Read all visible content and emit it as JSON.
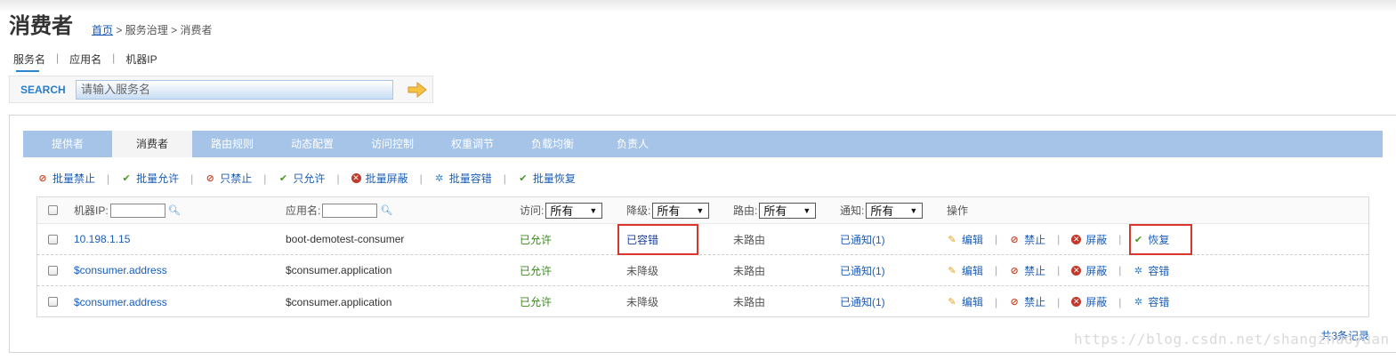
{
  "page": {
    "title": "消费者",
    "breadcrumb": {
      "home": "首页",
      "sep1": ">",
      "section": "服务治理",
      "sep2": ">",
      "current": "消费者"
    }
  },
  "search": {
    "tabs": [
      "服务名",
      "应用名",
      "机器IP"
    ],
    "separator": "|",
    "label": "SEARCH",
    "placeholder": "请输入服务名"
  },
  "nav": {
    "tabs": [
      "提供者",
      "消费者",
      "路由规则",
      "动态配置",
      "访问控制",
      "权重调节",
      "负载均衡",
      "负责人"
    ],
    "active": "消费者"
  },
  "batch_actions": [
    {
      "label": "批量禁止",
      "icon": "ban-icon"
    },
    {
      "label": "批量允许",
      "icon": "check-icon"
    },
    {
      "label": "只禁止",
      "icon": "ban-icon"
    },
    {
      "label": "只允许",
      "icon": "check-icon"
    },
    {
      "label": "批量屏蔽",
      "icon": "block-icon"
    },
    {
      "label": "批量容错",
      "icon": "gear-icon"
    },
    {
      "label": "批量恢复",
      "icon": "check-icon"
    }
  ],
  "table": {
    "headers": {
      "ip": "机器IP:",
      "app": "应用名:",
      "access": "访问:",
      "degrade": "降级:",
      "route": "路由:",
      "notify": "通知:",
      "ops": "操作"
    },
    "filters": {
      "access": "所有",
      "degrade": "所有",
      "route": "所有",
      "notify": "所有"
    },
    "rows": [
      {
        "ip": "10.198.1.15",
        "app": "boot-demotest-consumer",
        "access": "已允许",
        "degrade": "已容错",
        "route": "未路由",
        "notify": "已通知(1)",
        "ops": [
          "编辑",
          "禁止",
          "屏蔽",
          "恢复"
        ]
      },
      {
        "ip": "$consumer.address",
        "app": "$consumer.application",
        "access": "已允许",
        "degrade": "未降级",
        "route": "未路由",
        "notify": "已通知(1)",
        "ops": [
          "编辑",
          "禁止",
          "屏蔽",
          "容错"
        ]
      },
      {
        "ip": "$consumer.address",
        "app": "$consumer.application",
        "access": "已允许",
        "degrade": "未降级",
        "route": "未路由",
        "notify": "已通知(1)",
        "ops": [
          "编辑",
          "禁止",
          "屏蔽",
          "容错"
        ]
      }
    ],
    "record_count": "共3条记录"
  },
  "watermark": "https://blog.csdn.net/shangzhuoyuan"
}
